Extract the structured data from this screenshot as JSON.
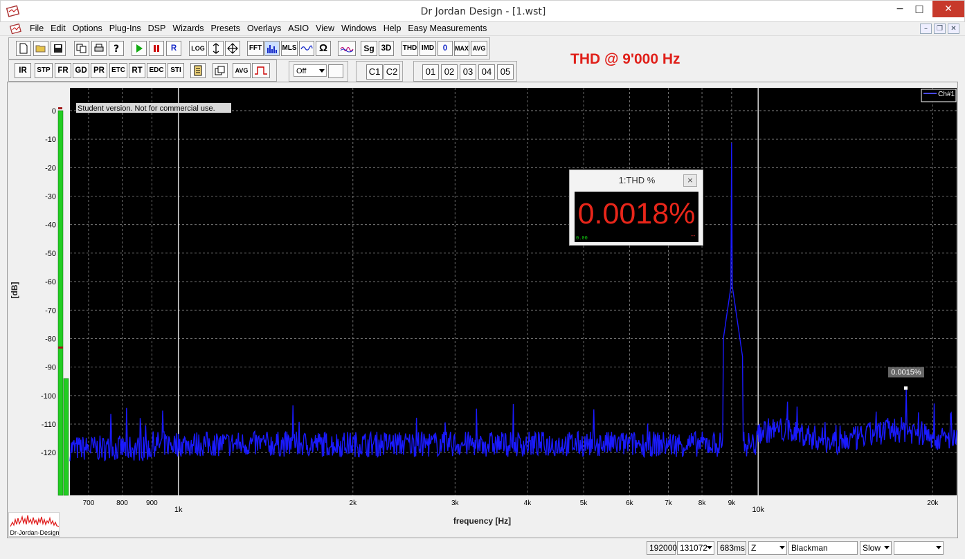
{
  "window": {
    "title": "Dr Jordan Design - [1.wst]",
    "min_label": "−",
    "max_label": "□",
    "close_label": "✕"
  },
  "menu": [
    "File",
    "Edit",
    "Options",
    "Plug-Ins",
    "DSP",
    "Wizards",
    "Presets",
    "Overlays",
    "ASIO",
    "View",
    "Windows",
    "Help",
    "Easy Measurements"
  ],
  "mdi": {
    "min": "–",
    "restore": "❐",
    "close": "✕"
  },
  "toolbar1": {
    "log_label": "LOG",
    "fft_label": "FFT",
    "mls_label": "MLS",
    "omega_label": "Ω",
    "sg_label": "Sg",
    "3d_label": "3D",
    "thd_label": "THD",
    "imd_label": "IMD",
    "zero_label": "0",
    "max_label": "MAX",
    "avg_label": "AVG",
    "r_label": "R"
  },
  "toolbar2": {
    "buttons": [
      "IR",
      "STP",
      "FR",
      "GD",
      "PR",
      "ETC",
      "RT",
      "EDC",
      "STI"
    ],
    "avg2_label": "AVG",
    "off_select": "Off",
    "c1_label": "C1",
    "c2_label": "C2",
    "presets": [
      "01",
      "02",
      "03",
      "04",
      "05"
    ]
  },
  "headline": "THD @ 9'000 Hz",
  "chart_data": {
    "type": "line",
    "xlabel": "frequency [Hz]",
    "ylabel": "[dB]",
    "xscale": "log",
    "xlim": [
      650,
      22000
    ],
    "ylim": [
      -135,
      8
    ],
    "y_ticks": [
      0,
      -10,
      -20,
      -30,
      -40,
      -50,
      -60,
      -70,
      -80,
      -90,
      -100,
      -110,
      -120
    ],
    "x_ticks_minor": [
      {
        "f": 700,
        "label": "700"
      },
      {
        "f": 800,
        "label": "800"
      },
      {
        "f": 900,
        "label": "900"
      },
      {
        "f": 2000,
        "label": "2k"
      },
      {
        "f": 3000,
        "label": "3k"
      },
      {
        "f": 4000,
        "label": "4k"
      },
      {
        "f": 5000,
        "label": "5k"
      },
      {
        "f": 6000,
        "label": "6k"
      },
      {
        "f": 7000,
        "label": "7k"
      },
      {
        "f": 8000,
        "label": "8k"
      },
      {
        "f": 9000,
        "label": "9k"
      },
      {
        "f": 20000,
        "label": "20k"
      }
    ],
    "x_ticks_major": [
      {
        "f": 1000,
        "label": "1k"
      },
      {
        "f": 10000,
        "label": "10k"
      }
    ],
    "grid": true,
    "watermark": "Student version. Not for commercial use.",
    "legend": {
      "label": "Ch#1",
      "position": "top-right"
    },
    "series": [
      {
        "name": "Ch#1",
        "color": "#1a1aff",
        "noise_floor_db": -117,
        "peaks": [
          {
            "f": 9000,
            "db": -1
          },
          {
            "f": 18000,
            "db": -97
          },
          {
            "f": 765,
            "db": -105
          },
          {
            "f": 860,
            "db": -104
          },
          {
            "f": 940,
            "db": -105
          },
          {
            "f": 21500,
            "db": -100
          }
        ]
      }
    ],
    "marker": {
      "f": 18000,
      "db": -97,
      "label": "0.0015%"
    },
    "level_meter": {
      "db": -94,
      "peak_db": -83
    }
  },
  "thd_panel": {
    "title": "1:THD %",
    "value": "0.0018%",
    "small": "0.00",
    "dash": "--",
    "close": "×"
  },
  "status": {
    "rate": "192000",
    "fft_size": "131072",
    "time": "683ms",
    "weighting": "Z",
    "window": "Blackman",
    "speed": "Slow",
    "extra": ""
  },
  "logo_text": "Dr-Jordan-Design",
  "colors": {
    "accent": "#e0201a",
    "trace": "#1a1aff",
    "meter": "#22cc22"
  }
}
